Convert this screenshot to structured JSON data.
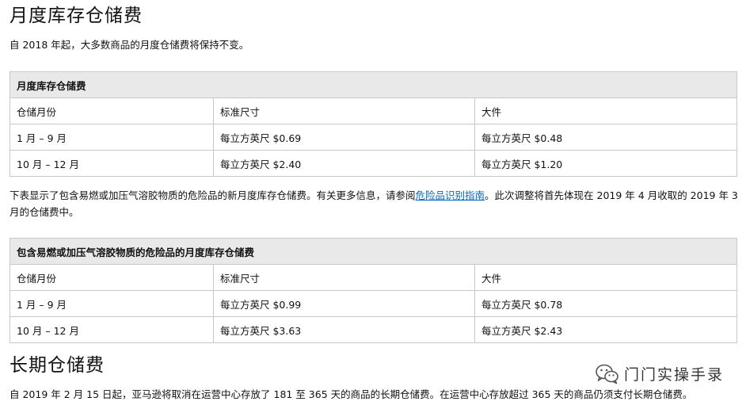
{
  "heading_monthly": "月度库存仓储费",
  "intro_text": "自 2018 年起，大多数商品的月度仓储费将保持不变。",
  "table_monthly": {
    "caption": "月度库存仓储费",
    "headers": [
      "仓储月份",
      "标准尺寸",
      "大件"
    ],
    "rows": [
      [
        "1 月 – 9 月",
        "每立方英尺 $0.69",
        "每立方英尺 $0.48"
      ],
      [
        "10 月 – 12 月",
        "每立方英尺 $2.40",
        "每立方英尺 $1.20"
      ]
    ]
  },
  "dangerous_goods_note": {
    "before_link": "下表显示了包含易燃或加压气溶胶物质的危险品的新月度库存仓储费。有关更多信息，请参阅",
    "link_text": "危险品识别指南",
    "after_link": "。此次调整将首先体现在 2019 年 4 月收取的 2019 年 3 月的仓储费中。"
  },
  "table_dangerous": {
    "caption": "包含易燃或加压气溶胶物质的危险品的月度库存仓储费",
    "headers": [
      "仓储月份",
      "标准尺寸",
      "大件"
    ],
    "rows": [
      [
        "1 月 – 9 月",
        "每立方英尺 $0.99",
        "每立方英尺 $0.78"
      ],
      [
        "10 月 – 12 月",
        "每立方英尺 $3.63",
        "每立方英尺 $2.43"
      ]
    ]
  },
  "heading_long_term": "长期仓储费",
  "long_term_text": "自 2019 年 2 月 15 日起，亚马逊将取消在运营中心存放了 181 至 365 天的商品的长期仓储费。在运营中心存放超过 365 天的商品仍须支付长期仓储费。",
  "watermark": {
    "icon": "wechat-icon",
    "text": "门门实操手录"
  }
}
